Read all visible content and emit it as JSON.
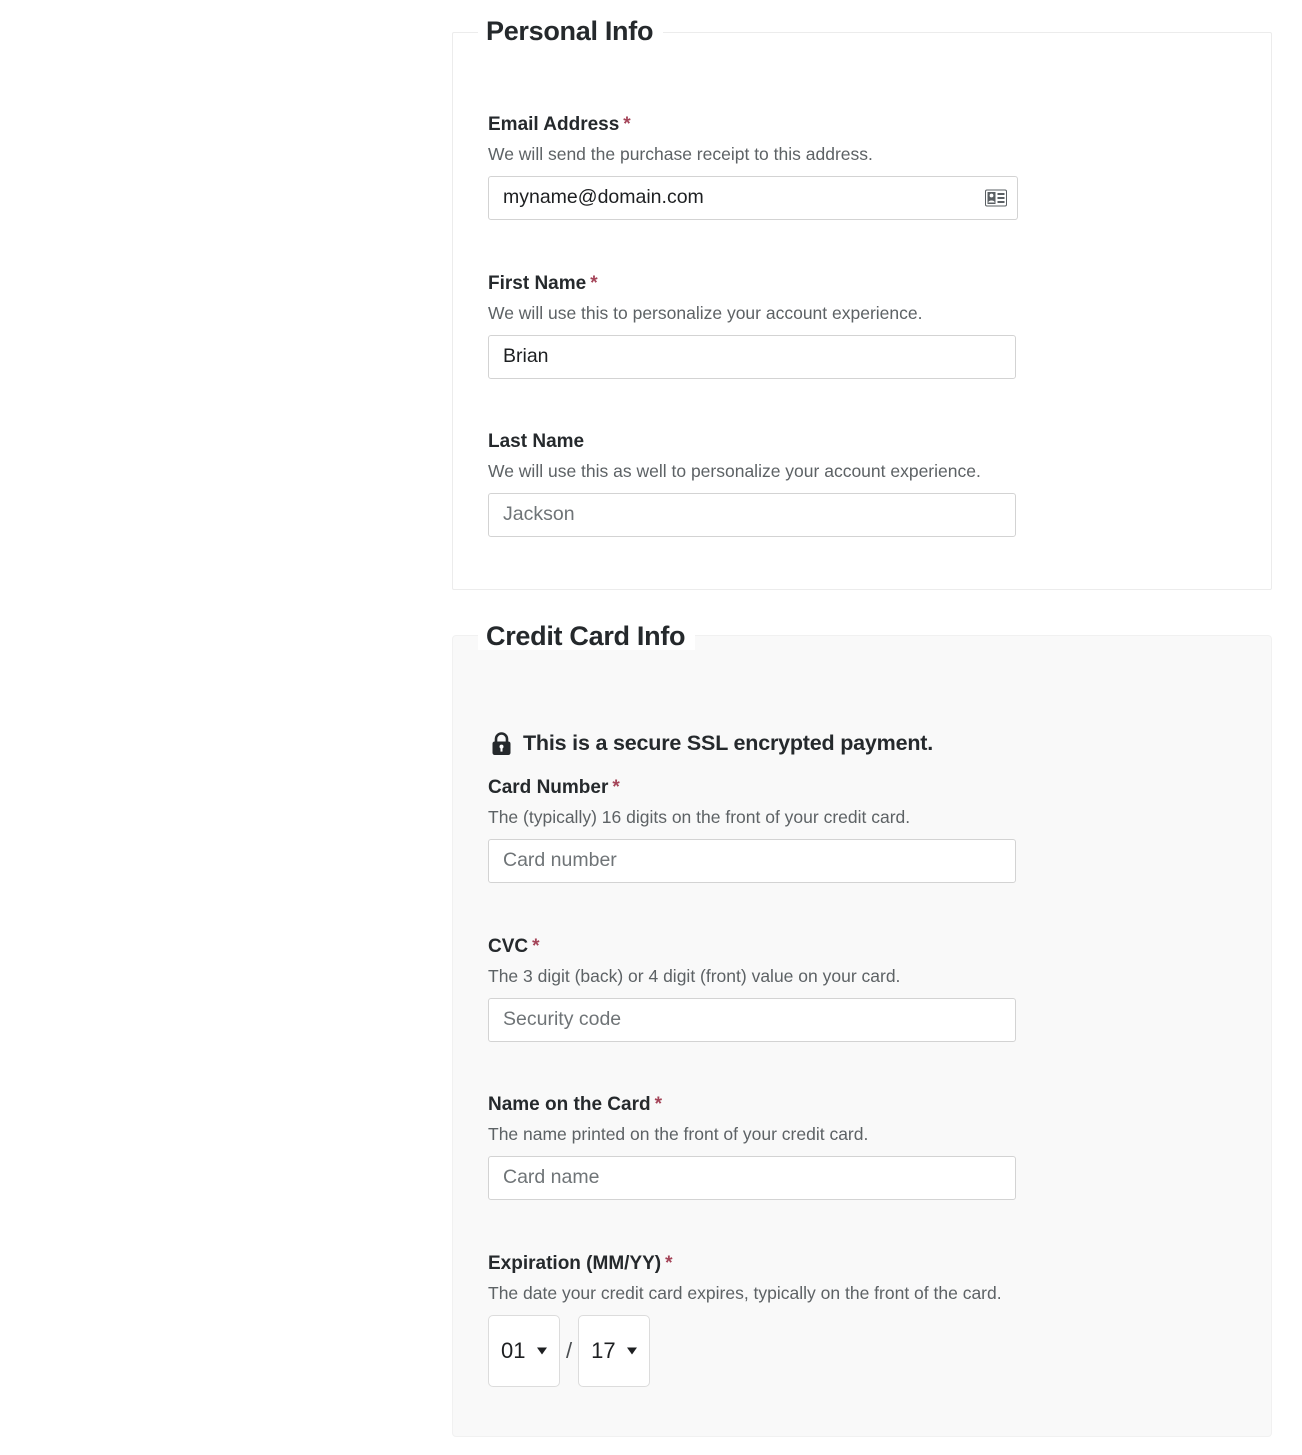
{
  "colors": {
    "required_asterisk": "#a44458",
    "heading": "#25292c",
    "help_text": "#5d6265",
    "panel_personal_bg": "#ffffff",
    "panel_card_bg": "#f9f9f9",
    "input_border": "#d3d3d3",
    "placeholder": "#6f7477"
  },
  "personal_info": {
    "legend": "Personal Info",
    "fields": [
      {
        "label": "Email Address",
        "required_marker": "*",
        "help": "We will send the purchase receipt to this address.",
        "value": "myname@domain.com",
        "placeholder": "",
        "is_filled": true,
        "icon": "contact-card-autofill-icon"
      },
      {
        "label": "First Name",
        "required_marker": "*",
        "help": "We will use this to personalize your account experience.",
        "value": "Brian",
        "placeholder": "",
        "is_filled": true
      },
      {
        "label": "Last Name",
        "required_marker": "",
        "help": "We will use this as well to personalize your account experience.",
        "value": "",
        "placeholder": "Jackson",
        "is_filled": false
      }
    ]
  },
  "credit_card_info": {
    "legend": "Credit Card Info",
    "ssl_notice": {
      "icon": "lock-icon",
      "text": "This is a secure SSL encrypted payment."
    },
    "fields": [
      {
        "label": "Card Number",
        "required_marker": "*",
        "help": "The (typically) 16 digits on the front of your credit card.",
        "value": "",
        "placeholder": "Card number",
        "is_filled": false
      },
      {
        "label": "CVC",
        "required_marker": "*",
        "help": "The 3 digit (back) or 4 digit (front) value on your card.",
        "value": "",
        "placeholder": "Security code",
        "is_filled": false
      },
      {
        "label": "Name on the Card",
        "required_marker": "*",
        "help": "The name printed on the front of your credit card.",
        "value": "",
        "placeholder": "Card name",
        "is_filled": false
      }
    ],
    "expiration": {
      "label": "Expiration (MM/YY)",
      "required_marker": "*",
      "help": "The date your credit card expires, typically on the front of the card.",
      "month_selected": "01",
      "separator": "/",
      "year_selected": "17"
    }
  }
}
